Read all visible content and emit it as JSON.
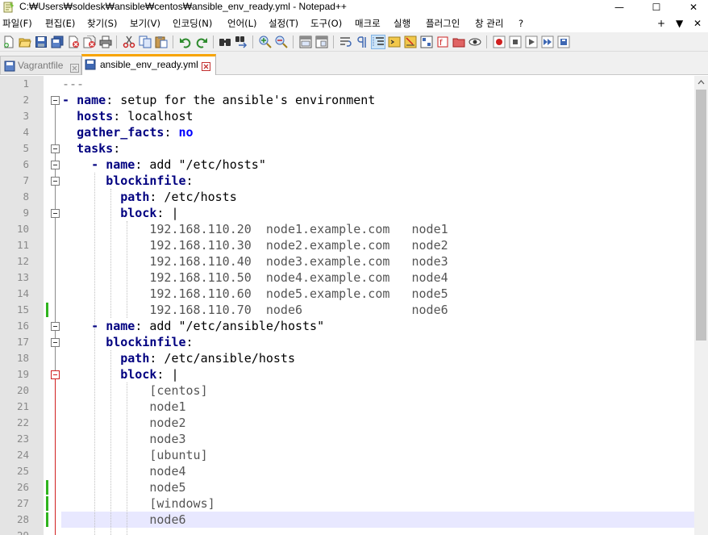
{
  "window": {
    "title": "C:₩Users₩soldesk₩ansible₩centos₩ansible_env_ready.yml - Notepad++",
    "minimize": "—",
    "maximize": "☐",
    "close": "✕"
  },
  "menu": {
    "items": [
      "파일(F)",
      "편집(E)",
      "찾기(S)",
      "보기(V)",
      "인코딩(N)",
      "언어(L)",
      "설정(T)",
      "도구(O)",
      "매크로",
      "실행",
      "플러그인",
      "창 관리",
      "?"
    ],
    "right": [
      "+",
      "▼",
      "✕"
    ]
  },
  "toolbar": {
    "icons": [
      "new-file-icon",
      "open-file-icon",
      "save-icon",
      "save-all-icon",
      "close-icon",
      "close-all-icon",
      "print-icon",
      "cut-icon",
      "copy-icon",
      "paste-icon",
      "undo-icon",
      "redo-icon",
      "find-icon",
      "replace-icon",
      "zoom-in-icon",
      "zoom-out-icon",
      "sync-vertical-icon",
      "sync-horizontal-icon",
      "word-wrap-icon",
      "show-all-chars-icon",
      "indent-guide-icon",
      "user-language-icon",
      "document-map-icon",
      "function-list-icon",
      "folder-workspace-icon",
      "monitoring-icon",
      "record-macro-icon",
      "stop-record-icon",
      "play-macro-icon",
      "run-macro-multiple-icon",
      "save-macro-icon"
    ]
  },
  "tabs": [
    {
      "label": "Vagrantfile",
      "active": false,
      "close": "✕"
    },
    {
      "label": "ansible_env_ready.yml",
      "active": true,
      "close": "✕"
    }
  ],
  "editor": {
    "current_line": 28,
    "colors": {
      "key": "#000080",
      "bool": "#0000ff",
      "current_line_bg": "#e8e8ff",
      "gutter_bg": "#e4e4e4",
      "change_bar": "#2fb41e",
      "fold_highlight": "#d02020",
      "tab_accent": "#f7a400"
    },
    "lines": [
      {
        "n": "1",
        "text": "---"
      },
      {
        "n": "2",
        "text": "- name: setup for the ansible's environment"
      },
      {
        "n": "3",
        "text": "  hosts: localhost"
      },
      {
        "n": "4",
        "text": "  gather_facts: no"
      },
      {
        "n": "5",
        "text": "  tasks:"
      },
      {
        "n": "6",
        "text": "    - name: add \"/etc/hosts\""
      },
      {
        "n": "7",
        "text": "      blockinfile:"
      },
      {
        "n": "8",
        "text": "        path: /etc/hosts"
      },
      {
        "n": "9",
        "text": "        block: |"
      },
      {
        "n": "10",
        "text": "            192.168.110.20  node1.example.com   node1"
      },
      {
        "n": "11",
        "text": "            192.168.110.30  node2.example.com   node2"
      },
      {
        "n": "12",
        "text": "            192.168.110.40  node3.example.com   node3"
      },
      {
        "n": "13",
        "text": "            192.168.110.50  node4.example.com   node4"
      },
      {
        "n": "14",
        "text": "            192.168.110.60  node5.example.com   node5"
      },
      {
        "n": "15",
        "text": "            192.168.110.70  node6               node6"
      },
      {
        "n": "16",
        "text": "    - name: add \"/etc/ansible/hosts\""
      },
      {
        "n": "17",
        "text": "      blockinfile:"
      },
      {
        "n": "18",
        "text": "        path: /etc/ansible/hosts"
      },
      {
        "n": "19",
        "text": "        block: |"
      },
      {
        "n": "20",
        "text": "            [centos]"
      },
      {
        "n": "21",
        "text": "            node1"
      },
      {
        "n": "22",
        "text": "            node2"
      },
      {
        "n": "23",
        "text": "            node3"
      },
      {
        "n": "24",
        "text": "            [ubuntu]"
      },
      {
        "n": "25",
        "text": "            node4"
      },
      {
        "n": "26",
        "text": "            node5"
      },
      {
        "n": "27",
        "text": "            [windows]"
      },
      {
        "n": "28",
        "text": "            node6"
      },
      {
        "n": "29",
        "text": ""
      }
    ]
  }
}
